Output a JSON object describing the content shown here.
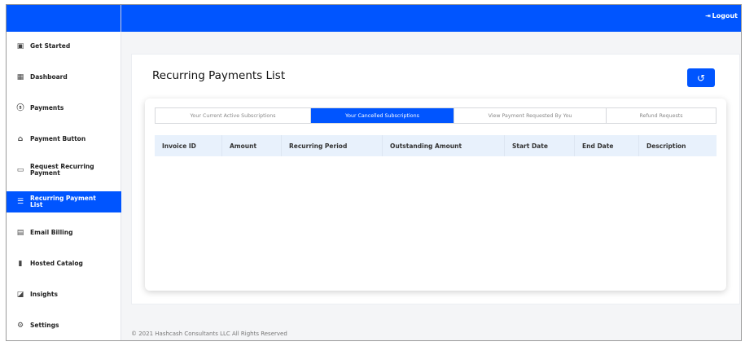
{
  "header": {
    "logout_label": "Logout"
  },
  "sidebar": {
    "items": [
      {
        "label": "Get Started",
        "icon": "briefcase-check-icon",
        "glyph": "▣"
      },
      {
        "label": "Dashboard",
        "icon": "dashboard-icon",
        "glyph": "▦"
      },
      {
        "label": "Payments",
        "icon": "dollar-circle-icon",
        "glyph": "ⓢ"
      },
      {
        "label": "Payment Button",
        "icon": "bank-icon",
        "glyph": "⌂"
      },
      {
        "label": "Request Recurring Payment",
        "icon": "card-add-icon",
        "glyph": "▭"
      },
      {
        "label": "Recurring Payment List",
        "icon": "list-icon",
        "glyph": "☰",
        "active": true
      },
      {
        "label": "Email Billing",
        "icon": "document-icon",
        "glyph": "▤"
      },
      {
        "label": "Hosted Catalog",
        "icon": "book-icon",
        "glyph": "▮"
      },
      {
        "label": "Insights",
        "icon": "chart-icon",
        "glyph": "◪"
      },
      {
        "label": "Settings",
        "icon": "gear-icon",
        "glyph": "⚙"
      }
    ]
  },
  "main": {
    "title": "Recurring Payments List",
    "tabs": [
      "Your Current Active Subscriptions",
      "Your Cancelled Subscriptions",
      "View Payment Requested By You",
      "Refund Requests"
    ],
    "active_tab": 1,
    "columns": [
      "Invoice ID",
      "Amount",
      "Recurring Period",
      "Outstanding Amount",
      "Start Date",
      "End Date",
      "Description"
    ],
    "rows": []
  },
  "footer": {
    "text": "© 2021 Hashcash Consultants LLC All Rights Reserved"
  },
  "colors": {
    "accent": "#0055ff",
    "table_header": "#e8f1fc"
  }
}
